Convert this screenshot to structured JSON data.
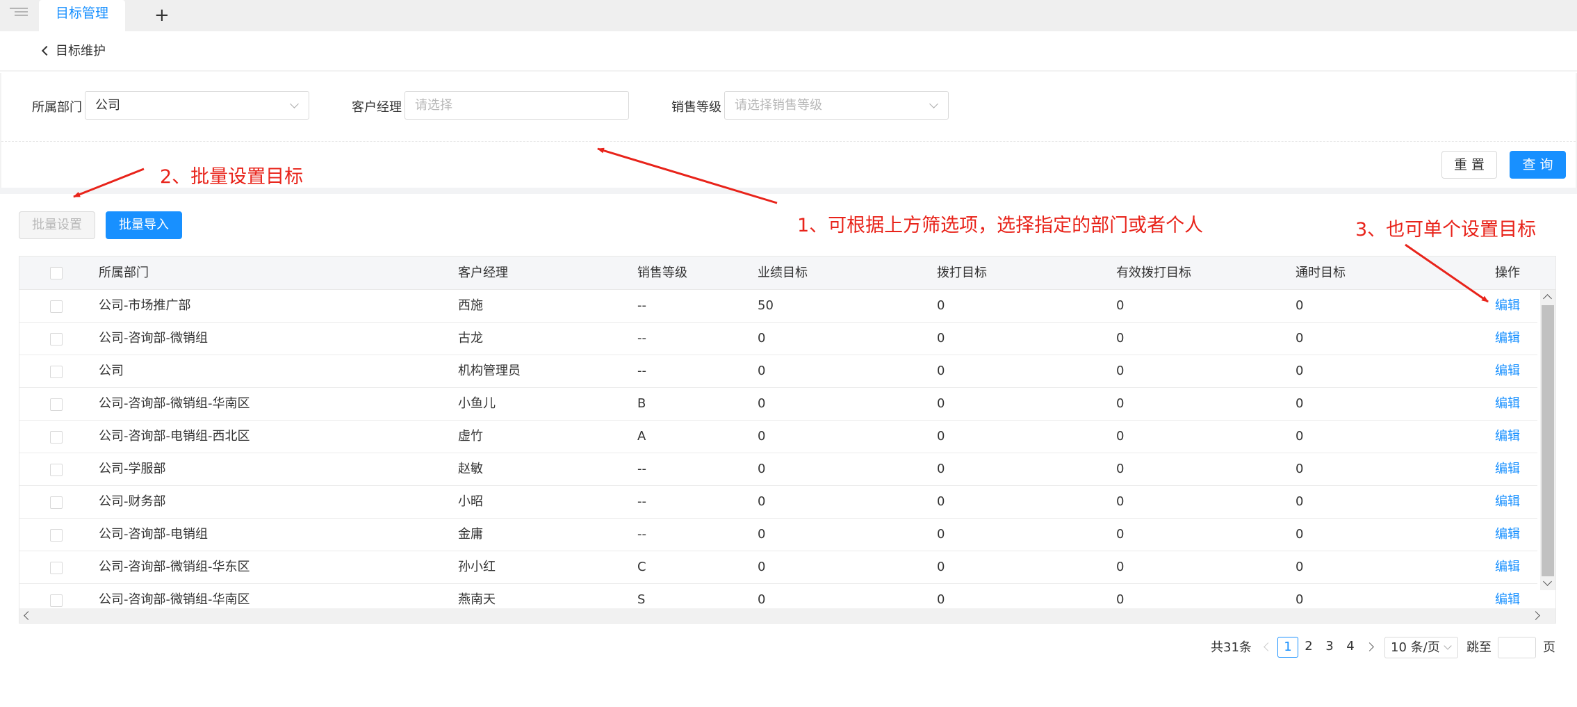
{
  "tabs": {
    "active_label": "目标管理",
    "add_label": "+"
  },
  "breadcrumb": {
    "back_label": "目标维护"
  },
  "filters": {
    "department": {
      "label": "所属部门",
      "value": "公司"
    },
    "manager": {
      "label": "客户经理",
      "placeholder": "请选择"
    },
    "sales_level": {
      "label": "销售等级",
      "placeholder": "请选择销售等级"
    }
  },
  "buttons": {
    "reset": "重 置",
    "query": "查 询",
    "batch_set": "批量设置",
    "batch_import": "批量导入"
  },
  "table": {
    "columns": [
      "所属部门",
      "客户经理",
      "销售等级",
      "业绩目标",
      "拨打目标",
      "有效拨打目标",
      "通时目标",
      "操作"
    ],
    "rows": [
      {
        "dept": "公司-市场推广部",
        "manager": "西施",
        "level": "--",
        "perf": "50",
        "call": "0",
        "valid": "0",
        "talk": "0",
        "action": "编辑"
      },
      {
        "dept": "公司-咨询部-微销组",
        "manager": "古龙",
        "level": "--",
        "perf": "0",
        "call": "0",
        "valid": "0",
        "talk": "0",
        "action": "编辑"
      },
      {
        "dept": "公司",
        "manager": "机构管理员",
        "level": "--",
        "perf": "0",
        "call": "0",
        "valid": "0",
        "talk": "0",
        "action": "编辑"
      },
      {
        "dept": "公司-咨询部-微销组-华南区",
        "manager": "小鱼儿",
        "level": "B",
        "perf": "0",
        "call": "0",
        "valid": "0",
        "talk": "0",
        "action": "编辑"
      },
      {
        "dept": "公司-咨询部-电销组-西北区",
        "manager": "虚竹",
        "level": "A",
        "perf": "0",
        "call": "0",
        "valid": "0",
        "talk": "0",
        "action": "编辑"
      },
      {
        "dept": "公司-学服部",
        "manager": "赵敏",
        "level": "--",
        "perf": "0",
        "call": "0",
        "valid": "0",
        "talk": "0",
        "action": "编辑"
      },
      {
        "dept": "公司-财务部",
        "manager": "小昭",
        "level": "--",
        "perf": "0",
        "call": "0",
        "valid": "0",
        "talk": "0",
        "action": "编辑"
      },
      {
        "dept": "公司-咨询部-电销组",
        "manager": "金庸",
        "level": "--",
        "perf": "0",
        "call": "0",
        "valid": "0",
        "talk": "0",
        "action": "编辑"
      },
      {
        "dept": "公司-咨询部-微销组-华东区",
        "manager": "孙小红",
        "level": "C",
        "perf": "0",
        "call": "0",
        "valid": "0",
        "talk": "0",
        "action": "编辑"
      },
      {
        "dept": "公司-咨询部-微销组-华南区",
        "manager": "燕南天",
        "level": "S",
        "perf": "0",
        "call": "0",
        "valid": "0",
        "talk": "0",
        "action": "编辑"
      }
    ]
  },
  "pagination": {
    "total": "共31条",
    "pages": [
      "1",
      "2",
      "3",
      "4"
    ],
    "current": "1",
    "page_size": "10 条/页",
    "jump_label": "跳至",
    "page_suffix": "页"
  },
  "annotations": {
    "a1": "1、可根据上方筛选项，选择指定的部门或者个人",
    "a2": "2、批量设置目标",
    "a3": "3、也可单个设置目标"
  },
  "colors": {
    "primary": "#1890ff",
    "annotation": "#e8231a"
  }
}
